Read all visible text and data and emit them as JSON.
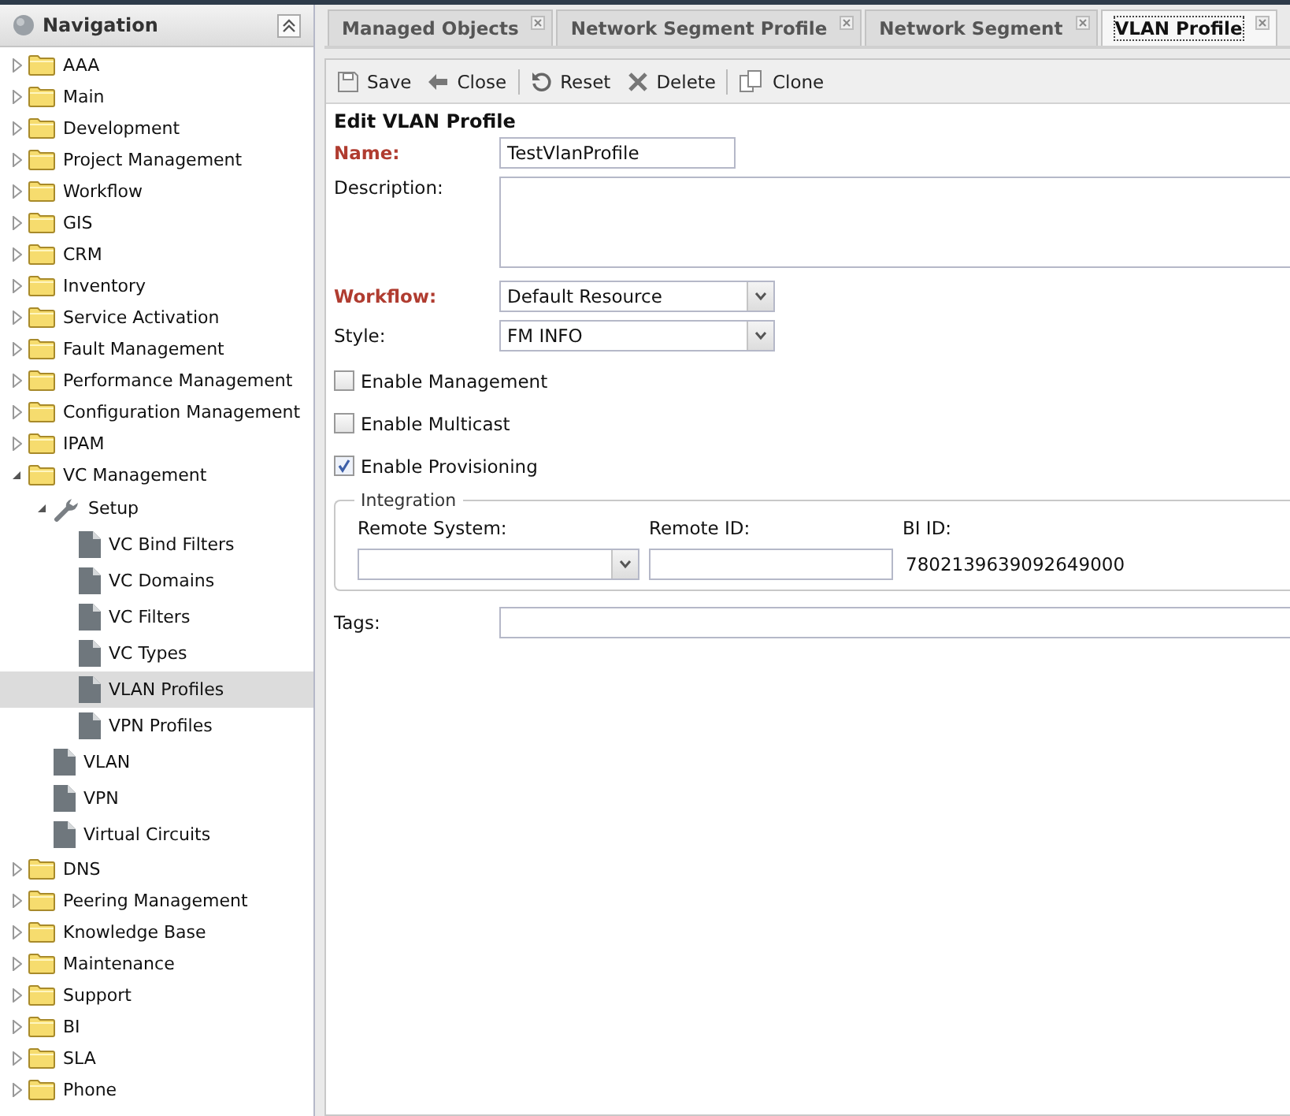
{
  "navigation": {
    "title": "Navigation",
    "tree": [
      {
        "label": "AAA",
        "kind": "folder",
        "expanded": false,
        "selected": false
      },
      {
        "label": "Main",
        "kind": "folder",
        "expanded": false,
        "selected": false
      },
      {
        "label": "Development",
        "kind": "folder",
        "expanded": false,
        "selected": false
      },
      {
        "label": "Project Management",
        "kind": "folder",
        "expanded": false,
        "selected": false
      },
      {
        "label": "Workflow",
        "kind": "folder",
        "expanded": false,
        "selected": false
      },
      {
        "label": "GIS",
        "kind": "folder",
        "expanded": false,
        "selected": false
      },
      {
        "label": "CRM",
        "kind": "folder",
        "expanded": false,
        "selected": false
      },
      {
        "label": "Inventory",
        "kind": "folder",
        "expanded": false,
        "selected": false
      },
      {
        "label": "Service Activation",
        "kind": "folder",
        "expanded": false,
        "selected": false
      },
      {
        "label": "Fault Management",
        "kind": "folder",
        "expanded": false,
        "selected": false
      },
      {
        "label": "Performance Management",
        "kind": "folder",
        "expanded": false,
        "selected": false
      },
      {
        "label": "Configuration Management",
        "kind": "folder",
        "expanded": false,
        "selected": false
      },
      {
        "label": "IPAM",
        "kind": "folder",
        "expanded": false,
        "selected": false
      },
      {
        "label": "VC Management",
        "kind": "folder",
        "expanded": true,
        "selected": false,
        "children": [
          {
            "label": "Setup",
            "kind": "tool",
            "expanded": true,
            "selected": false,
            "children": [
              {
                "label": "VC Bind Filters",
                "kind": "page",
                "selected": false
              },
              {
                "label": "VC Domains",
                "kind": "page",
                "selected": false
              },
              {
                "label": "VC Filters",
                "kind": "page",
                "selected": false
              },
              {
                "label": "VC Types",
                "kind": "page",
                "selected": false
              },
              {
                "label": "VLAN Profiles",
                "kind": "page",
                "selected": true
              },
              {
                "label": "VPN Profiles",
                "kind": "page",
                "selected": false
              }
            ]
          },
          {
            "label": "VLAN",
            "kind": "page",
            "selected": false
          },
          {
            "label": "VPN",
            "kind": "page",
            "selected": false
          },
          {
            "label": "Virtual Circuits",
            "kind": "page",
            "selected": false
          }
        ]
      },
      {
        "label": "DNS",
        "kind": "folder",
        "expanded": false,
        "selected": false
      },
      {
        "label": "Peering Management",
        "kind": "folder",
        "expanded": false,
        "selected": false
      },
      {
        "label": "Knowledge Base",
        "kind": "folder",
        "expanded": false,
        "selected": false
      },
      {
        "label": "Maintenance",
        "kind": "folder",
        "expanded": false,
        "selected": false
      },
      {
        "label": "Support",
        "kind": "folder",
        "expanded": false,
        "selected": false
      },
      {
        "label": "BI",
        "kind": "folder",
        "expanded": false,
        "selected": false
      },
      {
        "label": "SLA",
        "kind": "folder",
        "expanded": false,
        "selected": false
      },
      {
        "label": "Phone",
        "kind": "folder",
        "expanded": false,
        "selected": false
      }
    ]
  },
  "tabs": [
    {
      "label": "Managed Objects",
      "selected": false
    },
    {
      "label": "Network Segment Profile",
      "selected": false
    },
    {
      "label": "Network Segment",
      "selected": false
    },
    {
      "label": "VLAN Profile",
      "selected": true
    }
  ],
  "toolbar": [
    {
      "label": "Save",
      "kind": "save"
    },
    {
      "label": "Close",
      "kind": "close"
    },
    {
      "label": "Reset",
      "kind": "reset"
    },
    {
      "label": "Delete",
      "kind": "delete"
    },
    {
      "label": "Clone",
      "kind": "clone"
    }
  ],
  "form": {
    "title": "Edit VLAN Profile",
    "fields": [
      {
        "label": "Name:",
        "kind": "text",
        "required": true,
        "value": "TestVlanProfile"
      },
      {
        "label": "Description:",
        "kind": "textarea",
        "required": false
      },
      {
        "label": "Workflow:",
        "kind": "select",
        "required": true,
        "value": "Default Resource"
      },
      {
        "label": "Style:",
        "kind": "select",
        "required": false,
        "value": "FM INFO"
      },
      {
        "label": "Enable Management",
        "kind": "checkbox",
        "checked": false
      },
      {
        "label": "Enable Multicast",
        "kind": "checkbox",
        "checked": false
      },
      {
        "label": "Enable Provisioning",
        "kind": "checkbox",
        "checked": true
      }
    ],
    "integration": {
      "legend": "Integration",
      "remote_system": {
        "label": "Remote System:"
      },
      "remote_id": {
        "label": "Remote ID:"
      },
      "bi_id": {
        "label": "BI ID:",
        "value": "7802139639092649000"
      }
    },
    "tags": {
      "label": "Tags:"
    }
  }
}
